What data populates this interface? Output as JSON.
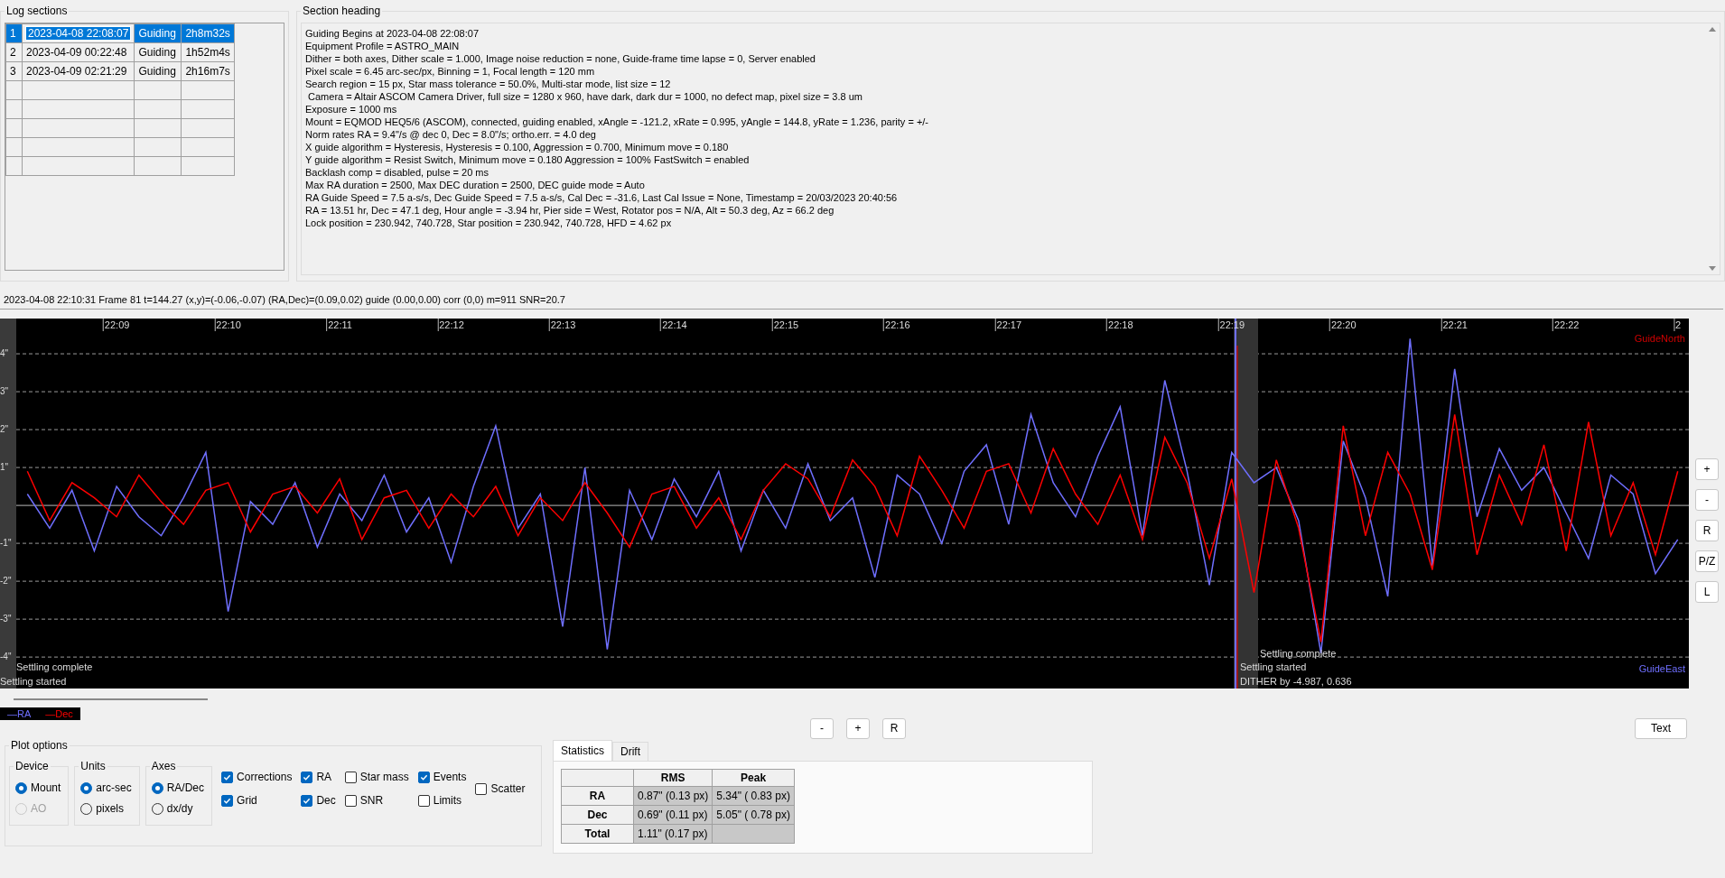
{
  "log_sections": {
    "title": "Log sections",
    "rows": [
      {
        "index": "1",
        "start": "2023-04-08 22:08:07",
        "type": "Guiding",
        "duration": "2h8m32s",
        "selected": true
      },
      {
        "index": "2",
        "start": "2023-04-09 00:22:48",
        "type": "Guiding",
        "duration": "1h52m4s",
        "selected": false
      },
      {
        "index": "3",
        "start": "2023-04-09 02:21:29",
        "type": "Guiding",
        "duration": "2h16m7s",
        "selected": false
      }
    ]
  },
  "section_heading": {
    "title": "Section heading",
    "lines": [
      "Guiding Begins at 2023-04-08 22:08:07",
      "Equipment Profile = ASTRO_MAIN",
      "Dither = both axes, Dither scale = 1.000, Image noise reduction = none, Guide-frame time lapse = 0, Server enabled",
      "Pixel scale = 6.45 arc-sec/px, Binning = 1, Focal length = 120 mm",
      "Search region = 15 px, Star mass tolerance = 50.0%, Multi-star mode, list size = 12",
      " Camera = Altair ASCOM Camera Driver, full size = 1280 x 960, have dark, dark dur = 1000, no defect map, pixel size = 3.8 um",
      "Exposure = 1000 ms",
      "Mount = EQMOD HEQ5/6 (ASCOM), connected, guiding enabled, xAngle = -121.2, xRate = 0.995, yAngle = 144.8, yRate = 1.236, parity = +/-",
      "Norm rates RA = 9.4\"/s @ dec 0, Dec = 8.0\"/s; ortho.err. = 4.0 deg",
      "X guide algorithm = Hysteresis, Hysteresis = 0.100, Aggression = 0.700, Minimum move = 0.180",
      "Y guide algorithm = Resist Switch, Minimum move = 0.180 Aggression = 100% FastSwitch = enabled",
      "Backlash comp = disabled, pulse = 20 ms",
      "Max RA duration = 2500, Max DEC duration = 2500, DEC guide mode = Auto",
      "RA Guide Speed = 7.5 a-s/s, Dec Guide Speed = 7.5 a-s/s, Cal Dec = -31.6, Last Cal Issue = None, Timestamp = 20/03/2023 20:40:56",
      "RA = 13.51 hr, Dec = 47.1 deg, Hour angle = -3.94 hr, Pier side = West, Rotator pos = N/A, Alt = 50.3 deg, Az = 66.2 deg",
      "Lock position = 230.942, 740.728, Star position = 230.942, 740.728, HFD = 4.62 px"
    ]
  },
  "status_line": "2023-04-08 22:10:31 Frame 81 t=144.27 (x,y)=(-0.06,-0.07) (RA,Dec)=(0.09,0.02) guide (0.00,0.00) corr (0,0) m=911 SNR=20.7",
  "graph": {
    "chart_data": {
      "type": "line",
      "grid": true,
      "ylim": [
        -4.83,
        4.93
      ],
      "categories": [
        null,
        null,
        null,
        null,
        "22:09",
        null,
        null,
        null,
        null,
        "22:10",
        null,
        null,
        null,
        null,
        "22:11",
        null,
        null,
        null,
        null,
        "22:12",
        null,
        null,
        null,
        null,
        "22:13",
        null,
        null,
        null,
        null,
        "22:14",
        null,
        null,
        null,
        null,
        "22:15",
        null,
        null,
        null,
        null,
        "22:16",
        null,
        null,
        null,
        null,
        "22:17",
        null,
        null,
        null,
        null,
        "22:18",
        null,
        null,
        null,
        null,
        "22:19",
        null,
        null,
        null,
        null,
        "22:20",
        null,
        null,
        null,
        null,
        "22:21",
        null,
        null,
        null,
        null,
        "22:22",
        null,
        null,
        null,
        null,
        "2"
      ],
      "yticks": [
        {
          "value": 4,
          "label": "4\""
        },
        {
          "value": 3,
          "label": "3\""
        },
        {
          "value": 2,
          "label": "2\""
        },
        {
          "value": 1,
          "label": "1\""
        },
        {
          "value": -1,
          "label": "-1\""
        },
        {
          "value": -2,
          "label": "-2\""
        },
        {
          "value": -3,
          "label": "-3\""
        },
        {
          "value": -4,
          "label": "-4\""
        }
      ],
      "series": [
        {
          "name": "—RA",
          "color": "#6f6fff",
          "values": [
            0.3,
            -0.6,
            0.4,
            -1.2,
            0.5,
            -0.3,
            -0.8,
            0.2,
            1.4,
            -2.8,
            0.1,
            -0.5,
            0.6,
            -1.1,
            0.3,
            -0.4,
            0.8,
            -0.7,
            0.2,
            -1.5,
            0.5,
            2.1,
            -0.6,
            0.3,
            -3.2,
            1.0,
            -3.8,
            0.4,
            -0.9,
            0.7,
            -0.3,
            0.9,
            -1.2,
            0.4,
            -0.6,
            1.1,
            -0.4,
            0.2,
            -1.9,
            0.8,
            0.3,
            -1.0,
            0.9,
            1.6,
            -0.5,
            2.4,
            0.6,
            -0.3,
            1.3,
            2.6,
            -0.8,
            3.3,
            0.9,
            -2.1,
            1.4,
            0.6,
            1.0,
            -0.4,
            -3.9,
            1.7,
            0.2,
            -2.4,
            4.4,
            -1.6,
            3.6,
            -0.3,
            1.5,
            0.4,
            1.0,
            -0.2,
            -1.4,
            0.8,
            0.3,
            -1.8,
            -0.9
          ]
        },
        {
          "name": "—Dec",
          "color": "#ff0000",
          "values": [
            0.9,
            -0.4,
            0.6,
            0.2,
            -0.3,
            0.8,
            0.1,
            -0.5,
            0.4,
            0.6,
            -0.7,
            0.3,
            0.5,
            -0.2,
            0.7,
            -0.9,
            0.2,
            0.4,
            -0.6,
            0.3,
            -0.3,
            0.5,
            -0.8,
            0.2,
            -0.4,
            0.6,
            -0.2,
            -1.1,
            0.3,
            0.5,
            -0.6,
            0.2,
            -0.9,
            0.4,
            1.1,
            0.7,
            -0.3,
            1.2,
            0.5,
            -0.8,
            1.3,
            0.4,
            -0.6,
            0.9,
            1.1,
            -0.2,
            1.5,
            0.3,
            -0.5,
            0.8,
            -0.9,
            1.8,
            0.6,
            -1.4,
            0.7,
            -2.3,
            1.2,
            -0.6,
            -3.6,
            2.1,
            -0.8,
            1.4,
            0.3,
            -1.7,
            2.4,
            -1.3,
            0.8,
            -0.5,
            1.6,
            -1.2,
            2.2,
            -0.8,
            0.6,
            -1.3,
            0.9
          ]
        }
      ]
    },
    "events": [
      "Settling complete",
      "Settling started",
      "Settling complete",
      "Settling started",
      "DITHER by -4.987, 0.636"
    ],
    "guide_north": "GuideNorth",
    "guide_east": "GuideEast",
    "side_buttons": [
      "+",
      "-",
      "R",
      "P/Z",
      "L"
    ]
  },
  "zoom_buttons": [
    "-",
    "+",
    "R"
  ],
  "text_button": "Text",
  "plot_options": {
    "title": "Plot options",
    "groups": [
      {
        "title": "Device",
        "options": [
          {
            "label": "Mount",
            "selected": true,
            "disabled": false
          },
          {
            "label": "AO",
            "selected": false,
            "disabled": true
          }
        ]
      },
      {
        "title": "Units",
        "options": [
          {
            "label": "arc-sec",
            "selected": true,
            "disabled": false
          },
          {
            "label": "pixels",
            "selected": false,
            "disabled": false
          }
        ]
      },
      {
        "title": "Axes",
        "options": [
          {
            "label": "RA/Dec",
            "selected": true,
            "disabled": false
          },
          {
            "label": "dx/dy",
            "selected": false,
            "disabled": false
          }
        ]
      }
    ],
    "checkbox_columns": [
      [
        {
          "label": "Corrections",
          "checked": true
        },
        {
          "label": "Grid",
          "checked": true
        }
      ],
      [
        {
          "label": "RA",
          "checked": true
        },
        {
          "label": "Dec",
          "checked": true
        }
      ],
      [
        {
          "label": "Star mass",
          "checked": false
        },
        {
          "label": "SNR",
          "checked": false
        }
      ],
      [
        {
          "label": "Events",
          "checked": true
        },
        {
          "label": "Limits",
          "checked": false
        }
      ],
      [
        {
          "label": "Scatter",
          "checked": false
        }
      ]
    ]
  },
  "stats": {
    "tabs": [
      {
        "label": "Statistics",
        "selected": true
      },
      {
        "label": "Drift",
        "selected": false
      }
    ],
    "columns": [
      "RMS",
      "Peak"
    ],
    "rows": [
      {
        "label": "RA",
        "rms": "0.87\" (0.13 px)",
        "peak": "5.34\" ( 0.83 px)"
      },
      {
        "label": "Dec",
        "rms": "0.69\" (0.11 px)",
        "peak": "5.05\" ( 0.78 px)"
      },
      {
        "label": "Total",
        "rms": "1.11\" (0.17 px)"
      }
    ]
  }
}
